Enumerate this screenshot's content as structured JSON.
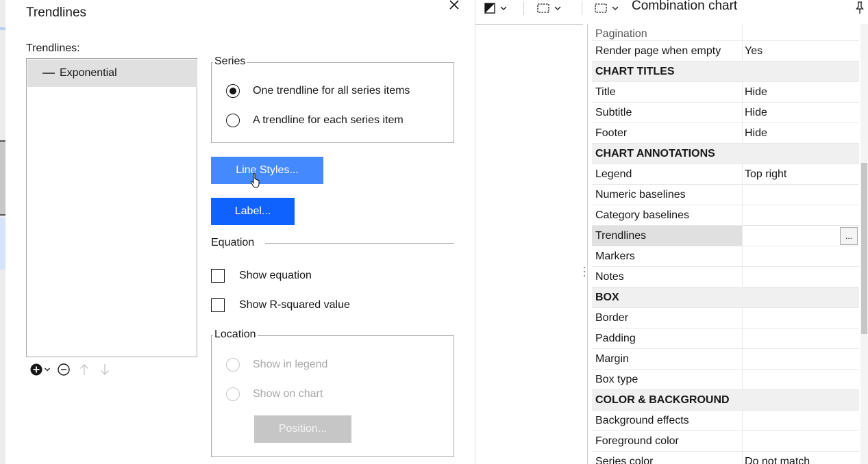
{
  "dialog": {
    "title": "Trendlines",
    "list_label": "Trendlines:",
    "items": [
      {
        "label": "Exponential"
      }
    ],
    "series": {
      "legend": "Series",
      "options": [
        {
          "label": "One trendline for all series items",
          "checked": true
        },
        {
          "label": "A trendline for each series item",
          "checked": false
        }
      ]
    },
    "buttons": {
      "line_styles": "Line Styles...",
      "label": "Label...",
      "position": "Position..."
    },
    "equation": {
      "title": "Equation",
      "show_equation": "Show equation",
      "show_r_squared": "Show R-squared value"
    },
    "location": {
      "legend": "Location",
      "show_in_legend": "Show in legend",
      "show_on_chart": "Show on chart"
    }
  },
  "properties": {
    "title": "Combination chart",
    "cut_row": "Pagination",
    "rows": [
      {
        "key": "Render page when empty",
        "value": "Yes"
      },
      {
        "section": "CHART TITLES"
      },
      {
        "key": "Title",
        "value": "Hide"
      },
      {
        "key": "Subtitle",
        "value": "Hide"
      },
      {
        "key": "Footer",
        "value": "Hide"
      },
      {
        "section": "CHART ANNOTATIONS"
      },
      {
        "key": "Legend",
        "value": "Top right"
      },
      {
        "key": "Numeric baselines",
        "value": ""
      },
      {
        "key": "Category baselines",
        "value": ""
      },
      {
        "key": "Trendlines",
        "value": "",
        "selected": true,
        "ellipsis": "..."
      },
      {
        "key": "Markers",
        "value": ""
      },
      {
        "key": "Notes",
        "value": ""
      },
      {
        "section": "BOX"
      },
      {
        "key": "Border",
        "value": ""
      },
      {
        "key": "Padding",
        "value": ""
      },
      {
        "key": "Margin",
        "value": ""
      },
      {
        "key": "Box type",
        "value": ""
      },
      {
        "section": "COLOR & BACKGROUND"
      },
      {
        "key": "Background effects",
        "value": ""
      },
      {
        "key": "Foreground color",
        "value": ""
      },
      {
        "key": "Series color",
        "value": "Do not match"
      }
    ]
  },
  "colors": {
    "primary_button": "#0f62fe",
    "hover_button": "#4589ff",
    "disabled_button": "#c6c6c6",
    "selected_row": "#e0e0e0",
    "section_row": "#f0f0f0"
  },
  "icons": [
    "close-icon",
    "add-circle-icon",
    "chevron-down-icon",
    "remove-circle-icon",
    "arrow-up-icon",
    "arrow-down-icon",
    "contrast-icon",
    "select-marquee-icon",
    "pin-icon",
    "hand-cursor-icon"
  ]
}
